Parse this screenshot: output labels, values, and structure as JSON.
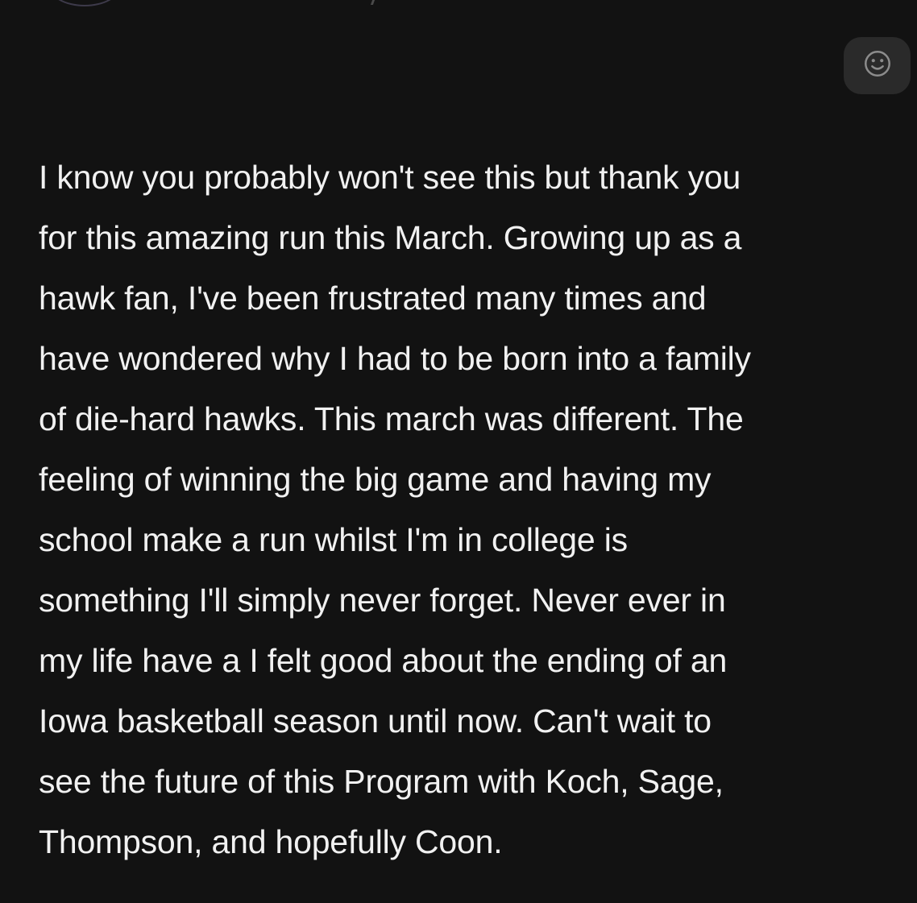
{
  "header": {
    "avatar_icon": "avatar",
    "react_icon": "smiley-face-icon"
  },
  "message": {
    "text": "I know you probably won't see this but thank you\nfor this amazing run this March. Growing up as a\nhawk fan, I've been frustrated many times and\nhave wondered why I had to be born into a family\nof die-hard hawks. This march was different. The\nfeeling of winning the big game and having my\nschool make a run whilst I'm in college is\nsomething I'll simply never forget. Never ever in\nmy life have a I felt good about the ending of an\nIowa basketball season until now. Can't wait to\nsee the future of this Program with Koch, Sage,\nThompson, and hopefully Coon."
  },
  "colors": {
    "background": "#121212",
    "text": "#f1f1f1",
    "button_bg": "#2a2a2a",
    "icon": "#8c8c8c"
  }
}
